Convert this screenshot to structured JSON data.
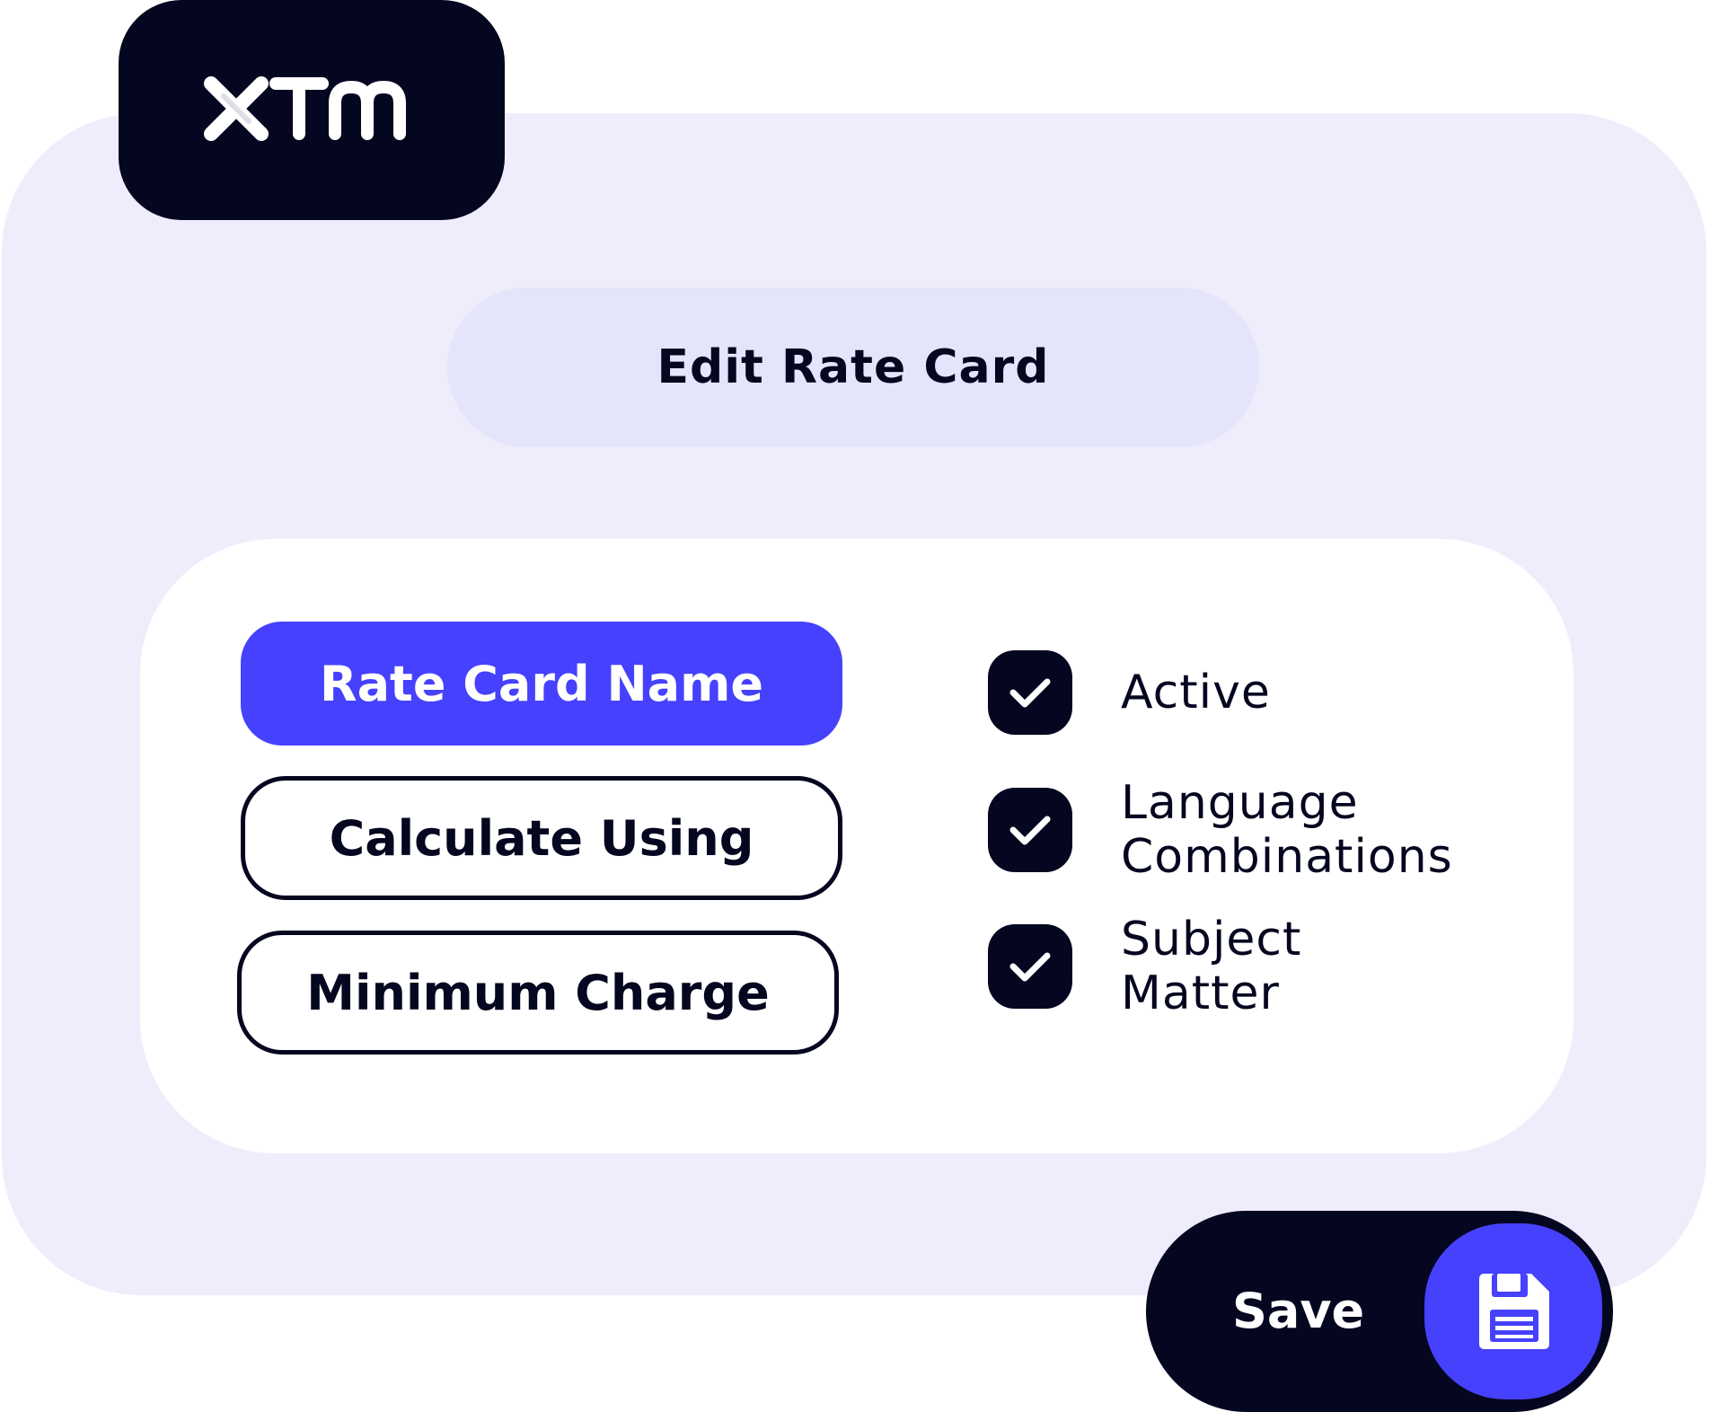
{
  "brand": {
    "logo_text": "XTM",
    "colors": {
      "dark": "#05061f",
      "accent": "#4641fc",
      "background": "#efedfc",
      "title_pill": "#e4e4fb",
      "white": "#ffffff"
    }
  },
  "header": {
    "title": "Edit Rate Card"
  },
  "fields": {
    "rate_card_name": "Rate Card Name",
    "calculate_using": "Calculate Using",
    "minimum_charge": "Minimum Charge"
  },
  "options": {
    "active": {
      "label": "Active",
      "checked": true
    },
    "language_combinations": {
      "label_line1": "Language",
      "label_line2": "Combinations",
      "checked": true
    },
    "subject_matter": {
      "label_line1": "Subject",
      "label_line2": "Matter",
      "checked": true
    }
  },
  "actions": {
    "save_label": "Save",
    "save_icon": "floppy-disk-icon"
  }
}
